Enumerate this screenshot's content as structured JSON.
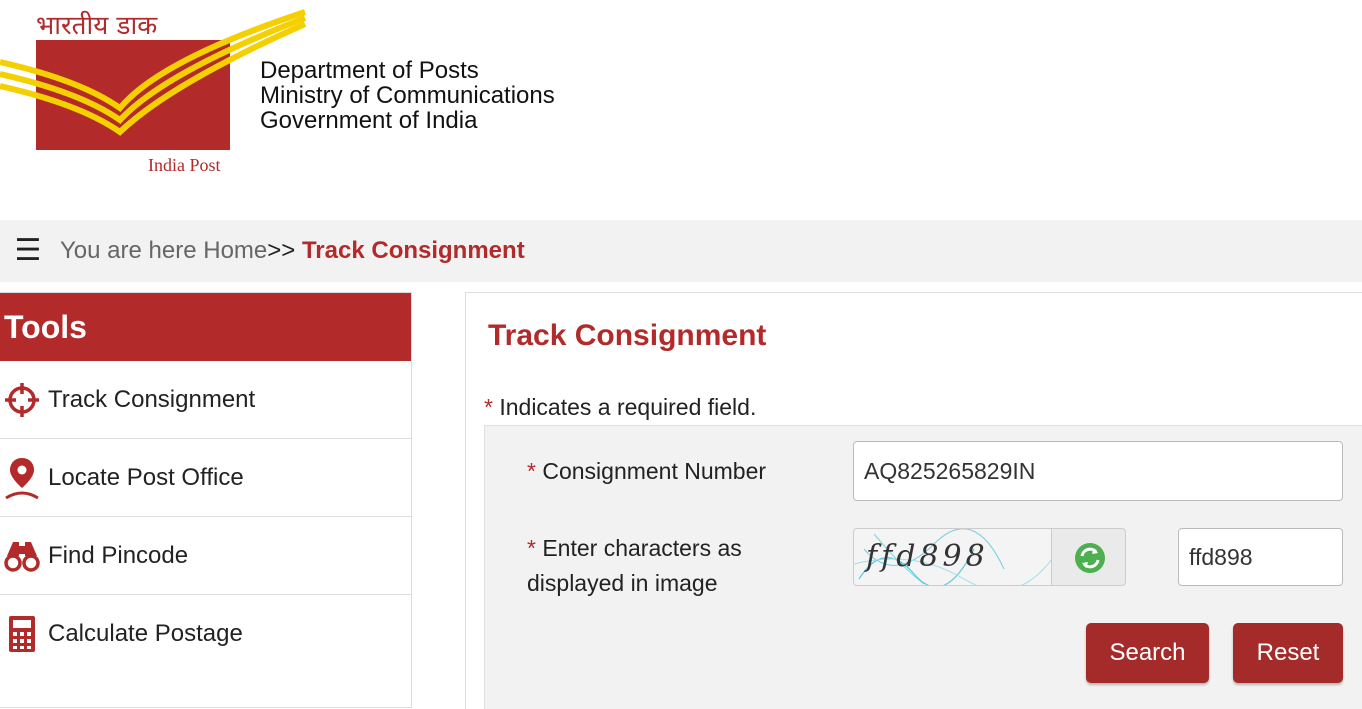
{
  "header": {
    "logo_hindi": "भारतीय डाक",
    "logo_english": "India Post",
    "department_lines": [
      "Department of Posts",
      "Ministry of Communications",
      "Government of India"
    ]
  },
  "breadcrumb": {
    "menu_icon": "hamburger-icon",
    "prefix": "You are here ",
    "home": "Home",
    "separator": ">> ",
    "current": "Track Consignment"
  },
  "sidebar": {
    "title": "Tools",
    "items": [
      {
        "label": "Track Consignment",
        "icon": "crosshair-icon"
      },
      {
        "label": "Locate Post Office",
        "icon": "map-pin-icon"
      },
      {
        "label": "Find Pincode",
        "icon": "binoculars-icon"
      },
      {
        "label": "Calculate Postage",
        "icon": "calculator-icon"
      }
    ]
  },
  "main": {
    "title": "Track Consignment",
    "required_star": "*",
    "required_note": " Indicates a required field.",
    "form": {
      "consignment_label": " Consignment Number",
      "consignment_value": "AQ825265829IN",
      "captcha_label": " Enter characters as displayed in image",
      "captcha_image_text": "ffd898",
      "captcha_value": "ffd898",
      "refresh_icon": "refresh-icon",
      "search_label": "Search",
      "reset_label": "Reset"
    }
  },
  "colors": {
    "brand_red": "#b22a2a",
    "button_red": "#a52a2a",
    "logo_yellow": "#f5d000",
    "bar_gray": "#f2f2f2"
  }
}
